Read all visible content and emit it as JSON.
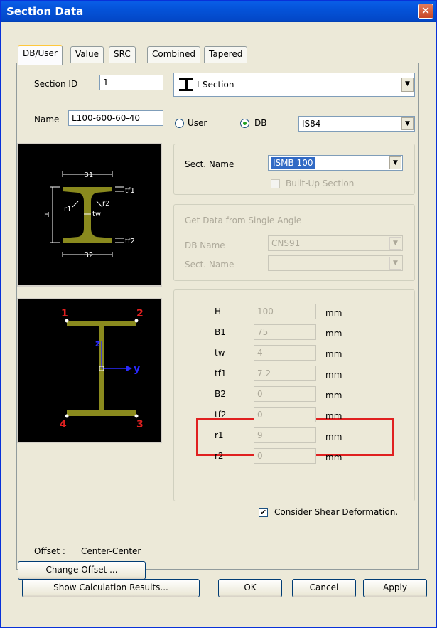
{
  "window": {
    "title": "Section Data",
    "close_glyph": "✕"
  },
  "tabs": [
    {
      "label": "DB/User"
    },
    {
      "label": "Value"
    },
    {
      "label": "SRC"
    },
    {
      "label": "Combined"
    },
    {
      "label": "Tapered"
    }
  ],
  "section_id": {
    "label": "Section ID",
    "value": "1"
  },
  "section_type": {
    "value": "I-Section",
    "icon": "i-section-icon"
  },
  "name": {
    "label": "Name",
    "value": "L100-600-60-40"
  },
  "source": {
    "user_label": "User",
    "db_label": "DB",
    "selected": "DB",
    "db_value": "IS84"
  },
  "sect_name": {
    "label": "Sect. Name",
    "value": "ISMB 100"
  },
  "built_up": {
    "label": "Built-Up Section",
    "checked": false
  },
  "single_angle": {
    "title": "Get Data from Single Angle",
    "db_name_label": "DB Name",
    "db_name_value": "CNS91",
    "sect_name_label": "Sect. Name",
    "sect_name_value": ""
  },
  "dims": [
    {
      "label": "H",
      "value": "100",
      "unit": "mm"
    },
    {
      "label": "B1",
      "value": "75",
      "unit": "mm"
    },
    {
      "label": "tw",
      "value": "4",
      "unit": "mm"
    },
    {
      "label": "tf1",
      "value": "7.2",
      "unit": "mm"
    },
    {
      "label": "B2",
      "value": "0",
      "unit": "mm"
    },
    {
      "label": "tf2",
      "value": "0",
      "unit": "mm"
    },
    {
      "label": "r1",
      "value": "9",
      "unit": "mm"
    },
    {
      "label": "r2",
      "value": "0",
      "unit": "mm"
    }
  ],
  "diagram_top": {
    "B1": "B1",
    "B2": "B2",
    "H": "H",
    "tf1": "tf1",
    "tf2": "tf2",
    "tw": "tw",
    "r1": "r1",
    "r2": "r2"
  },
  "diagram_bottom": {
    "p1": "1",
    "p2": "2",
    "p3": "3",
    "p4": "4",
    "y": "y",
    "z": "z"
  },
  "shear": {
    "label": "Consider Shear Deformation.",
    "checked": true,
    "check_glyph": "✔"
  },
  "offset": {
    "label": "Offset :",
    "value": "Center-Center",
    "button": "Change Offset ..."
  },
  "footer": {
    "show_results": "Show Calculation Results...",
    "ok": "OK",
    "cancel": "Cancel",
    "apply": "Apply"
  },
  "colors": {
    "title_bar": "#0453d9",
    "highlight": "#e02020",
    "section_fill": "#8a8a1e"
  }
}
